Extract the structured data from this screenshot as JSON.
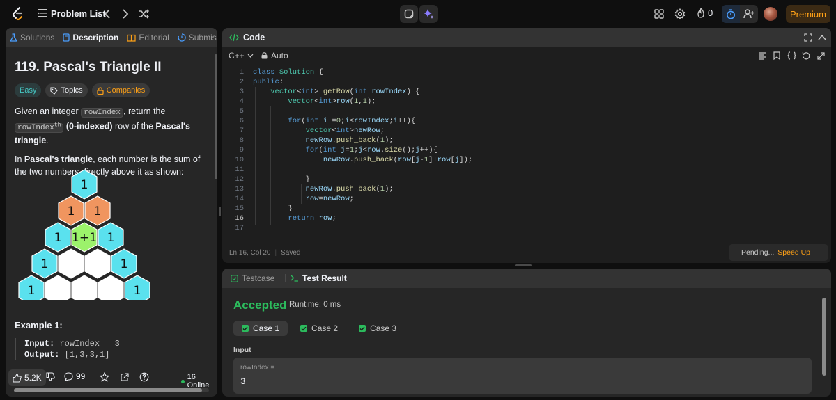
{
  "topbar": {
    "problem_list_label": "Problem List",
    "streak_count": "0",
    "premium_label": "Premium"
  },
  "left_tabs": [
    {
      "label": "Solutions"
    },
    {
      "label": "Description"
    },
    {
      "label": "Editorial"
    },
    {
      "label": "Submiss"
    }
  ],
  "problem": {
    "title": "119. Pascal's Triangle II",
    "tags": {
      "easy": "Easy",
      "topics": "Topics",
      "companies": "Companies"
    },
    "desc1_a": "Given an integer ",
    "code1": "rowIndex",
    "desc1_b": ", return the ",
    "code2": "rowIndex",
    "sup": "th",
    "bold1": " (0-indexed)",
    "desc1_c": " row of the ",
    "bold2": "Pascal's triangle",
    "desc1_d": ".",
    "desc2_a": "In ",
    "bold3": "Pascal's triangle",
    "desc2_b": ", each number is the sum of the two numbers directly above it as shown:",
    "triangle_labels": [
      "1",
      "1",
      "1",
      "1",
      "1+1",
      "1",
      "1",
      "1",
      "1",
      "1"
    ],
    "example_title": "Example 1:",
    "input_label": "Input:",
    "input_value": "rowIndex = 3",
    "output_label": "Output:",
    "output_value": "[1,3,3,1]"
  },
  "left_footer": {
    "likes": "5.2K",
    "comments": "99",
    "online": "16 Online"
  },
  "code_panel": {
    "title": "Code",
    "language": "C++",
    "mode": "Auto",
    "status_pos": "Ln 16, Col 20",
    "status_saved": "Saved",
    "pending": "Pending...",
    "speed_up": "Speed Up",
    "line_numbers": [
      "1",
      "2",
      "3",
      "4",
      "5",
      "6",
      "7",
      "8",
      "9",
      "10",
      "11",
      "12",
      "13",
      "14",
      "15",
      "16",
      "17"
    ],
    "lines": [
      "class Solution {",
      "public:",
      "    vector<int> getRow(int rowIndex) {",
      "        vector<int>row(1,1);",
      "",
      "        for(int i =0;i<rowIndex;i++){",
      "            vector<int>newRow;",
      "            newRow.push_back(1);",
      "            for(int j=1;j<row.size();j++){",
      "                newRow.push_back(row[j-1]+row[j]);",
      "",
      "            }",
      "            newRow.push_back(1);",
      "            row=newRow;",
      "        }",
      "        return row;",
      ""
    ]
  },
  "result_panel": {
    "tab_testcase": "Testcase",
    "tab_result": "Test Result",
    "status": "Accepted",
    "runtime": "Runtime: 0 ms",
    "cases": [
      "Case 1",
      "Case 2",
      "Case 3"
    ],
    "input_label": "Input",
    "var_name": "rowIndex =",
    "var_value": "3"
  },
  "colors": {
    "accent_orange": "#ffa116",
    "accepted_green": "#2cbb5d",
    "easy_teal": "#46c6c2",
    "hex_cyan": "#5ae1ee",
    "hex_orange": "#f0955f",
    "hex_green": "#9cf26b"
  }
}
